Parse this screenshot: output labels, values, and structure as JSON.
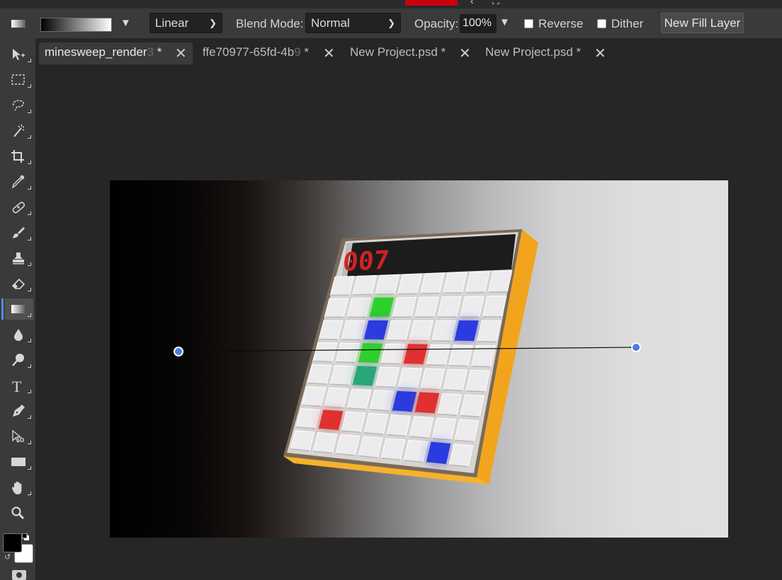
{
  "options_bar": {
    "gradient_type": "Linear",
    "blend_mode_label": "Blend Mode:",
    "blend_mode_value": "Normal",
    "opacity_label": "Opacity:",
    "opacity_value": "100%",
    "reverse_label": "Reverse",
    "reverse_checked": false,
    "dither_label": "Dither",
    "dither_checked": false,
    "new_fill_layer_label": "New Fill Layer"
  },
  "tabs": [
    {
      "label": "minesweep_render",
      "faded": "3",
      "suffix": " *",
      "active": true
    },
    {
      "label": "ffe70977-65fd-4b",
      "faded": "9",
      "suffix": " *",
      "active": false
    },
    {
      "label": "New Project.psd *",
      "faded": "",
      "suffix": "",
      "active": false
    },
    {
      "label": "New Project.psd *",
      "faded": "",
      "suffix": "",
      "active": false
    }
  ],
  "tools": [
    "move-tool",
    "marquee-tool",
    "lasso-tool",
    "magic-wand-tool",
    "crop-tool",
    "eyedropper-tool",
    "healing-brush-tool",
    "brush-tool",
    "clone-stamp-tool",
    "eraser-tool",
    "gradient-tool",
    "blur-tool",
    "dodge-tool",
    "type-tool",
    "pen-tool",
    "path-select-tool",
    "shape-tool",
    "hand-tool",
    "zoom-tool"
  ],
  "active_tool": "gradient-tool",
  "colors": {
    "foreground": "#000000",
    "background": "#ffffff",
    "accent": "#4b8df0",
    "handle": "#4a7de0"
  },
  "document": {
    "counter_display": "007"
  }
}
